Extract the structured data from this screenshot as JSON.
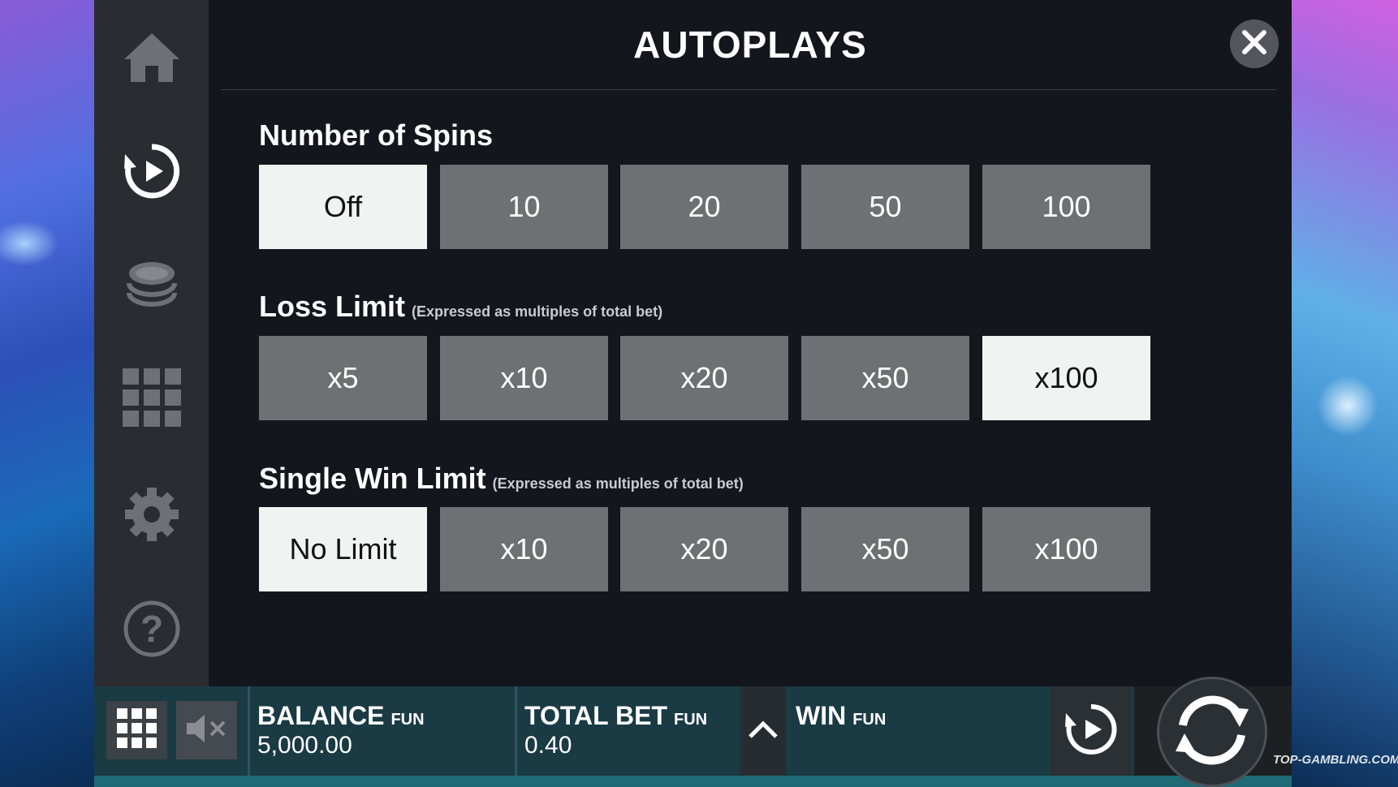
{
  "header": {
    "title": "AUTOPLAYS"
  },
  "sidebar": {
    "items": [
      {
        "name": "home-icon"
      },
      {
        "name": "autoplay-icon",
        "active": true
      },
      {
        "name": "coins-icon"
      },
      {
        "name": "paytable-grid-icon"
      },
      {
        "name": "settings-gear-icon"
      },
      {
        "name": "help-icon"
      }
    ]
  },
  "spins": {
    "label": "Number of Spins",
    "options": [
      "Off",
      "10",
      "20",
      "50",
      "100"
    ],
    "selected": "Off"
  },
  "loss_limit": {
    "label": "Loss Limit",
    "note": "(Expressed as multiples of total bet)",
    "options": [
      "x5",
      "x10",
      "x20",
      "x50",
      "x100"
    ],
    "selected": "x100"
  },
  "win_limit": {
    "label": "Single Win Limit",
    "note": "(Expressed as multiples of total bet)",
    "options": [
      "No Limit",
      "x10",
      "x20",
      "x50",
      "x100"
    ],
    "selected": "No Limit"
  },
  "bottom_bar": {
    "balance_label": "BALANCE",
    "balance_currency": "FUN",
    "balance_value": "5,000.00",
    "bet_label": "TOTAL BET",
    "bet_currency": "FUN",
    "bet_value": "0.40",
    "win_label": "WIN",
    "win_currency": "FUN"
  },
  "watermark": "TOP-GAMBLING.COM",
  "colors": {
    "selected_option_bg": "#f1f2f2",
    "option_bg": "#6e7074",
    "panel_bg": "#14161d",
    "sidebar_bg": "#2a2c31",
    "bottom_bar_bg": "#1a3a44"
  }
}
